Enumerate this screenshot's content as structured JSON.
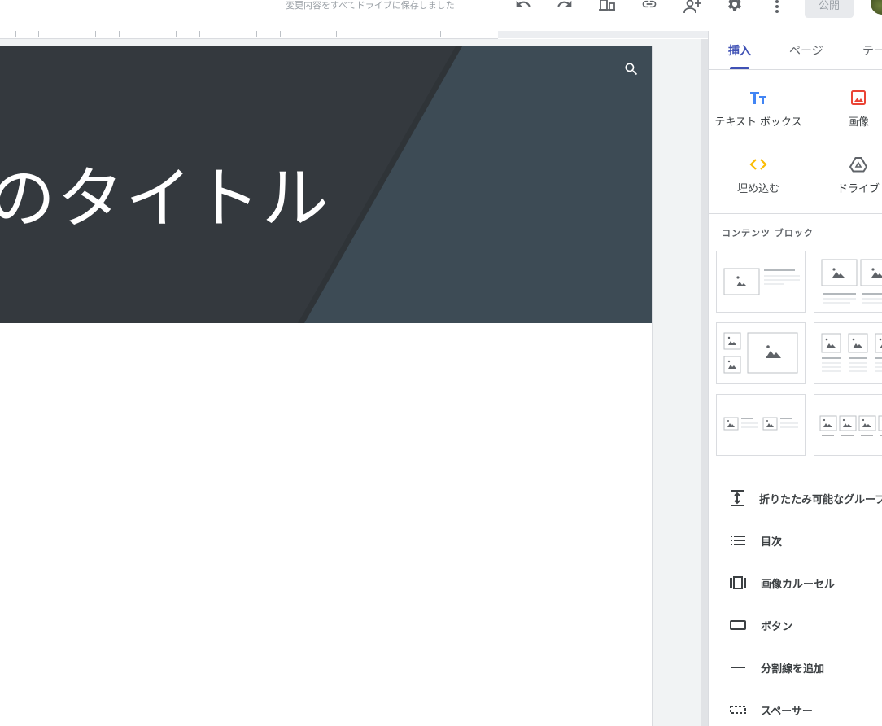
{
  "topbar": {
    "save_status": "変更内容をすべてドライブに保存しました",
    "publish_label": "公開",
    "icons": [
      "undo-icon",
      "redo-icon",
      "preview-icon",
      "link-icon",
      "share-icon",
      "settings-icon",
      "more-icon"
    ]
  },
  "page": {
    "hero_title": "のタイトル"
  },
  "panel": {
    "tabs": [
      {
        "label": "挿入",
        "active": true
      },
      {
        "label": "ページ",
        "active": false
      },
      {
        "label": "テーマ",
        "active": false
      }
    ],
    "insert_items": [
      {
        "label": "テキスト ボックス",
        "icon": "text-box-icon",
        "color": "#4285f4"
      },
      {
        "label": "画像",
        "icon": "image-icon",
        "color": "#ea4335"
      },
      {
        "label": "埋め込む",
        "icon": "embed-icon",
        "color": "#fbbc04"
      },
      {
        "label": "ドライブ",
        "icon": "drive-icon",
        "color": "#5f6368"
      }
    ],
    "content_blocks_title": "コンテンツ ブロック",
    "components": [
      {
        "label": "折りたたみ可能なグループ",
        "icon": "collapsible-group-icon"
      },
      {
        "label": "目次",
        "icon": "table-of-contents-icon"
      },
      {
        "label": "画像カルーセル",
        "icon": "image-carousel-icon"
      },
      {
        "label": "ボタン",
        "icon": "button-icon"
      },
      {
        "label": "分割線を追加",
        "icon": "divider-icon"
      },
      {
        "label": "スペーサー",
        "icon": "spacer-icon"
      }
    ]
  },
  "colors": {
    "accent": "#3f51b5",
    "hero_dark": "#34393e",
    "hero_light": "#3d4b55"
  }
}
